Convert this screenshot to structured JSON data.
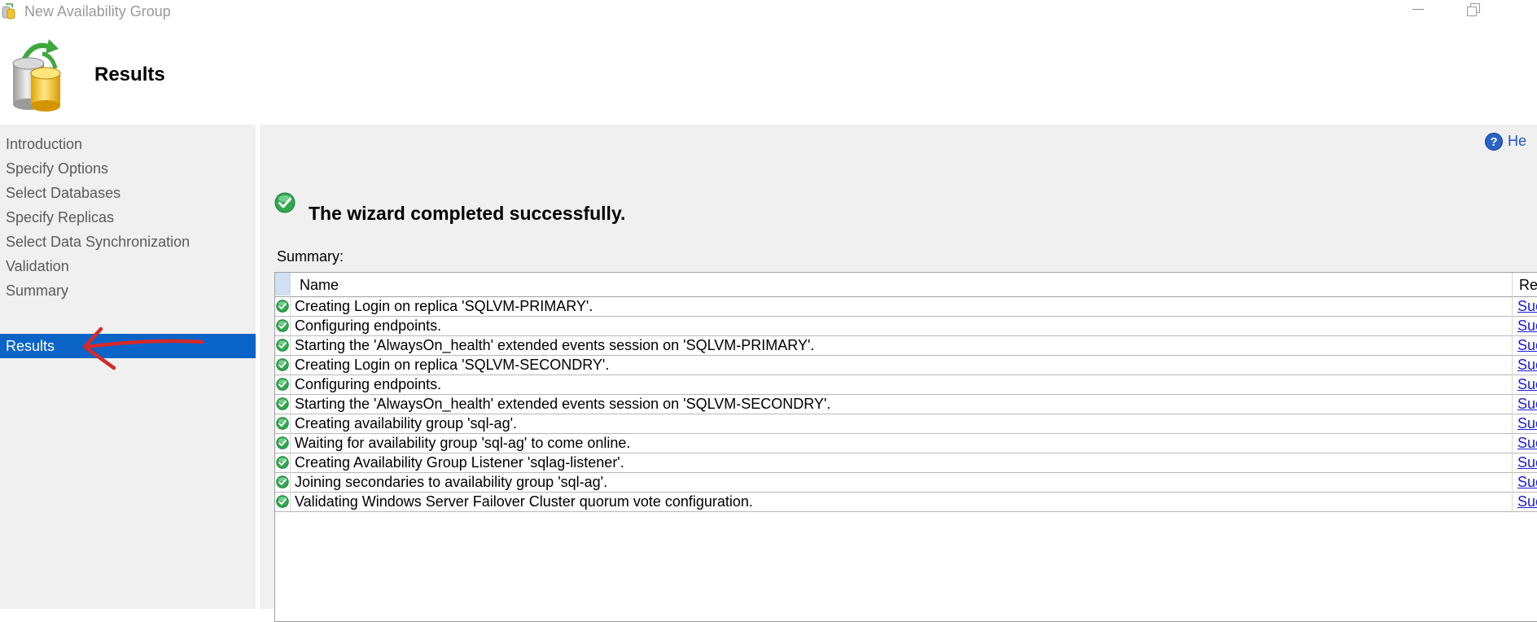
{
  "window": {
    "title": "New Availability Group"
  },
  "header": {
    "title": "Results"
  },
  "nav": {
    "items": [
      {
        "label": "Introduction"
      },
      {
        "label": "Specify Options"
      },
      {
        "label": "Select Databases"
      },
      {
        "label": "Specify Replicas"
      },
      {
        "label": "Select Data Synchronization"
      },
      {
        "label": "Validation"
      },
      {
        "label": "Summary"
      },
      {
        "label": "Results",
        "active": true
      }
    ]
  },
  "main": {
    "help_label": "He",
    "completed_message": "The wizard completed successfully.",
    "summary_label": "Summary:",
    "table": {
      "columns": [
        "Name",
        "Result"
      ],
      "rows": [
        {
          "name": "Creating Login on replica 'SQLVM-PRIMARY'.",
          "result": "Success"
        },
        {
          "name": "Configuring endpoints.",
          "result": "Success"
        },
        {
          "name": "Starting the 'AlwaysOn_health' extended events session on 'SQLVM-PRIMARY'.",
          "result": "Success"
        },
        {
          "name": "Creating Login on replica 'SQLVM-SECONDRY'.",
          "result": "Success"
        },
        {
          "name": "Configuring endpoints.",
          "result": "Success"
        },
        {
          "name": "Starting the 'AlwaysOn_health' extended events session on 'SQLVM-SECONDRY'.",
          "result": "Success"
        },
        {
          "name": "Creating availability group 'sql-ag'.",
          "result": "Success"
        },
        {
          "name": "Waiting for availability group 'sql-ag' to come online.",
          "result": "Success"
        },
        {
          "name": "Creating Availability Group Listener 'sqlag-listener'.",
          "result": "Success"
        },
        {
          "name": "Joining secondaries to availability group 'sql-ag'.",
          "result": "Success"
        },
        {
          "name": "Validating Windows Server Failover Cluster quorum vote configuration.",
          "result": "Success"
        }
      ]
    }
  },
  "colors": {
    "nav_active": "#0a64c8",
    "link": "#1a1ad8",
    "panel_bg": "#f0f0f0",
    "annotation_arrow": "#d42a2a"
  },
  "icons": {
    "app": "database-icon",
    "header": "database-sync-icon",
    "success": "green-check-icon",
    "help": "help-icon"
  }
}
